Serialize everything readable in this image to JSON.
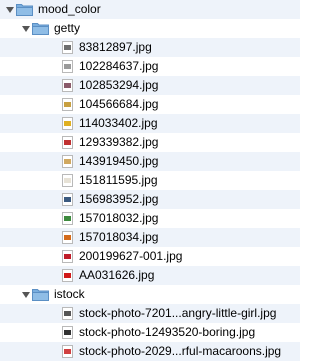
{
  "tree": {
    "root": {
      "name": "mood_color",
      "expanded": true,
      "icon": "folder-icon"
    },
    "folders": [
      {
        "name": "getty",
        "expanded": true,
        "files": [
          {
            "name": "83812897.jpg",
            "thumb_color": "#6e6e6e"
          },
          {
            "name": "102284637.jpg",
            "thumb_color": "#9a9a9a"
          },
          {
            "name": "102853294.jpg",
            "thumb_color": "#8a5a6a"
          },
          {
            "name": "104566684.jpg",
            "thumb_color": "#c8a040"
          },
          {
            "name": "114033402.jpg",
            "thumb_color": "#e0b020"
          },
          {
            "name": "129339382.jpg",
            "thumb_color": "#c03030"
          },
          {
            "name": "143919450.jpg",
            "thumb_color": "#d0a860"
          },
          {
            "name": "151811595.jpg",
            "thumb_color": "#e7e2d6"
          },
          {
            "name": "156983952.jpg",
            "thumb_color": "#3a5a80"
          },
          {
            "name": "157018032.jpg",
            "thumb_color": "#3d8a3d"
          },
          {
            "name": "157018034.jpg",
            "thumb_color": "#d46a1a"
          },
          {
            "name": "200199627-001.jpg",
            "thumb_color": "#c01c28"
          },
          {
            "name": "AA031626.jpg",
            "thumb_color": "#d01818"
          }
        ]
      },
      {
        "name": "istock",
        "expanded": true,
        "files": [
          {
            "name": "stock-photo-7201...angry-little-girl.jpg",
            "thumb_color": "#555555"
          },
          {
            "name": "stock-photo-12493520-boring.jpg",
            "thumb_color": "#303030"
          },
          {
            "name": "stock-photo-2029...rful-macaroons.jpg",
            "thumb_color": "#d04040"
          }
        ]
      }
    ]
  },
  "colors": {
    "row_alt": "#eef3fa",
    "folder_fill": "#8fbde6",
    "folder_stroke": "#5b8fc4",
    "disclosure": "#555555"
  }
}
